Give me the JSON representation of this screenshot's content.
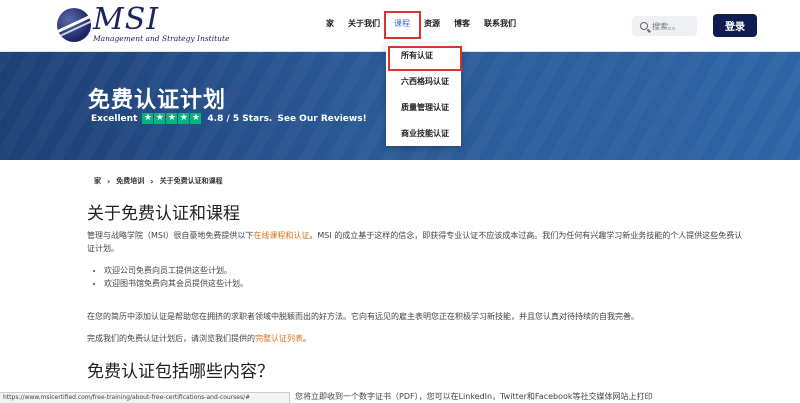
{
  "header": {
    "logo_title": "MSI",
    "logo_subtitle": "Management and Strategy Institute",
    "nav": [
      "家",
      "关于我们",
      "课程",
      "资源",
      "博客",
      "联系我们"
    ],
    "search_placeholder": "搜索。。",
    "login_label": "登录"
  },
  "dropdown": {
    "items": [
      "所有认证",
      "六西格玛认证",
      "质量管理认证",
      "商业技能认证"
    ]
  },
  "hero": {
    "title": "免费认证计划",
    "rating_word": "Excellent",
    "rating_value": "4.8 / 5 Stars.",
    "rating_cta": "See Our Reviews!"
  },
  "breadcrumb": [
    "家",
    "免费培训",
    "关于免费认证和课程"
  ],
  "content": {
    "heading1": "关于免费认证和课程",
    "p1_a": "管理与战略学院（MSI）很自豪地免费提供以下",
    "p1_link": "在线课程和认证",
    "p1_b": "。MSI 的成立基于这样的信念，即获得专业认证不应该成本过高。我们为任何有兴趣学习新业务技能的个人提供这些免费认证计划。",
    "bullets": [
      "欢迎公司免费向员工提供这些计划。",
      "欢迎图书馆免费向其会员提供这些计划。"
    ],
    "p2": "在您的简历中添加认证是帮助您在拥挤的求职者领域中脱颖而出的好方法。它向有远见的雇主表明您正在积极学习新技能，并且您认真对待持续的自我完善。",
    "p3_a": "完成我们的免费认证计划后，请浏览我们提供的",
    "p3_link": "完整认证列表",
    "p3_b": "。",
    "heading2": "免费认证包括哪些内容？",
    "p4": "该免费课程包括在线培训课程和认证考试。完成该计划后，您将立即收到一个数字证书（PDF），您可以在LinkedIn，Twitter和Facebook等社交媒体网站上打印"
  },
  "status_url": "https://www.msicertified.com/free-training/about-free-certifications-and-courses/#"
}
